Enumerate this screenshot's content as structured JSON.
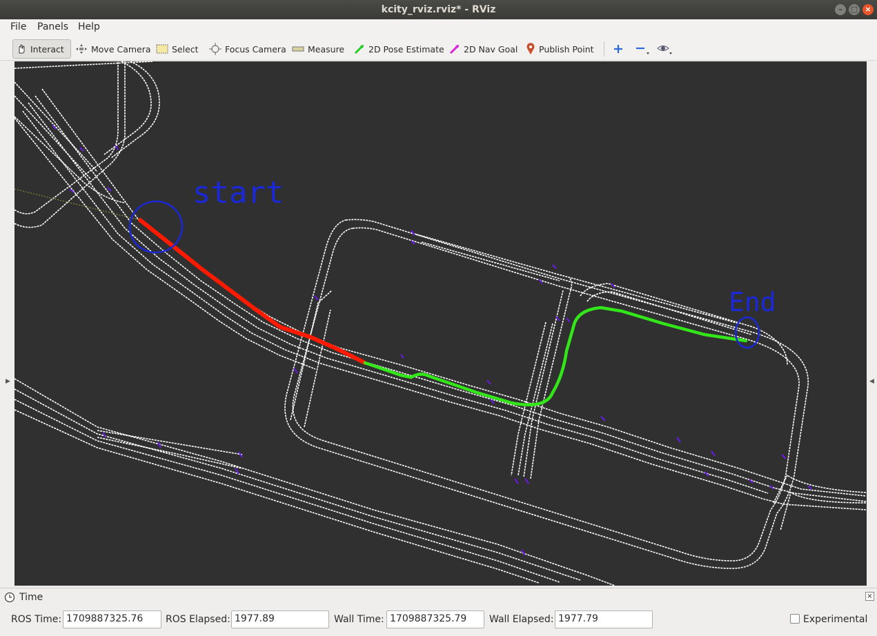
{
  "window": {
    "title": "kcity_rviz.rviz* - RViz"
  },
  "menu": {
    "file": "File",
    "panels": "Panels",
    "help": "Help"
  },
  "toolbar": {
    "interact": "Interact",
    "move_camera": "Move Camera",
    "select": "Select",
    "focus_camera": "Focus Camera",
    "measure": "Measure",
    "pose_estimate": "2D Pose Estimate",
    "nav_goal": "2D Nav Goal",
    "publish_point": "Publish Point"
  },
  "viewport": {
    "annotation_start": "start",
    "annotation_end": "End",
    "colors": {
      "background": "#303030",
      "lanes": "#ffffff",
      "path_traveled": "#ff1a00",
      "path_planned": "#33e61a",
      "markers": "#6a1ae6",
      "annotation": "#1a28d6"
    }
  },
  "time_panel": {
    "title": "Time",
    "ros_time_label": "ROS Time:",
    "ros_time": "1709887325.76",
    "ros_elapsed_label": "ROS Elapsed:",
    "ros_elapsed": "1977.89",
    "wall_time_label": "Wall Time:",
    "wall_time": "1709887325.79",
    "wall_elapsed_label": "Wall Elapsed:",
    "wall_elapsed": "1977.79",
    "experimental_label": "Experimental"
  }
}
